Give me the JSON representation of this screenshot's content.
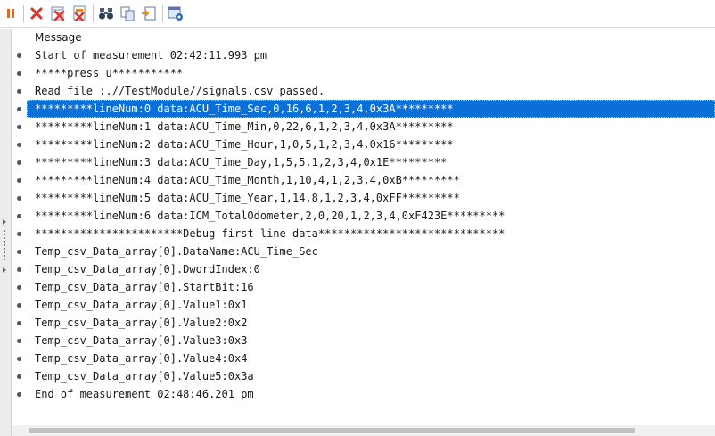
{
  "toolbar": {
    "buttons": [
      {
        "name": "pause-icon"
      },
      {
        "name": "clear-icon"
      },
      {
        "name": "clear-all-icon"
      },
      {
        "name": "clear-selected-icon"
      },
      {
        "name": "find-icon"
      },
      {
        "name": "copy-icon"
      },
      {
        "name": "export-icon"
      },
      {
        "name": "properties-icon"
      }
    ],
    "colors": {
      "accent_red": "#d9372b",
      "accent_orange": "#e88b1e",
      "accent_blue": "#2f6db5"
    }
  },
  "log": {
    "column_header": "Message",
    "selected_index": 4,
    "selection_color": "#0a6fd6",
    "lines": [
      "Start of measurement 02:42:11.993 pm",
      "*****press u***********",
      "Read file :.//TestModule//signals.csv passed.",
      "*********lineNum:0 data:ACU_Time_Sec,0,16,6,1,2,3,4,0x3A*********",
      "*********lineNum:1 data:ACU_Time_Min,0,22,6,1,2,3,4,0x3A*********",
      "*********lineNum:2 data:ACU_Time_Hour,1,0,5,1,2,3,4,0x16*********",
      "*********lineNum:3 data:ACU_Time_Day,1,5,5,1,2,3,4,0x1E*********",
      "*********lineNum:4 data:ACU_Time_Month,1,10,4,1,2,3,4,0xB*********",
      "*********lineNum:5 data:ACU_Time_Year,1,14,8,1,2,3,4,0xFF*********",
      "*********lineNum:6 data:ICM_TotalOdometer,2,0,20,1,2,3,4,0xF423E*********",
      "***********************Debug first line data*****************************",
      "Temp_csv_Data_array[0].DataName:ACU_Time_Sec",
      "Temp_csv_Data_array[0].DwordIndex:0",
      "Temp_csv_Data_array[0].StartBit:16",
      "Temp_csv_Data_array[0].Value1:0x1",
      "Temp_csv_Data_array[0].Value2:0x2",
      "Temp_csv_Data_array[0].Value3:0x3",
      "Temp_csv_Data_array[0].Value4:0x4",
      "Temp_csv_Data_array[0].Value5:0x3a",
      "End of measurement 02:48:46.201 pm"
    ]
  }
}
